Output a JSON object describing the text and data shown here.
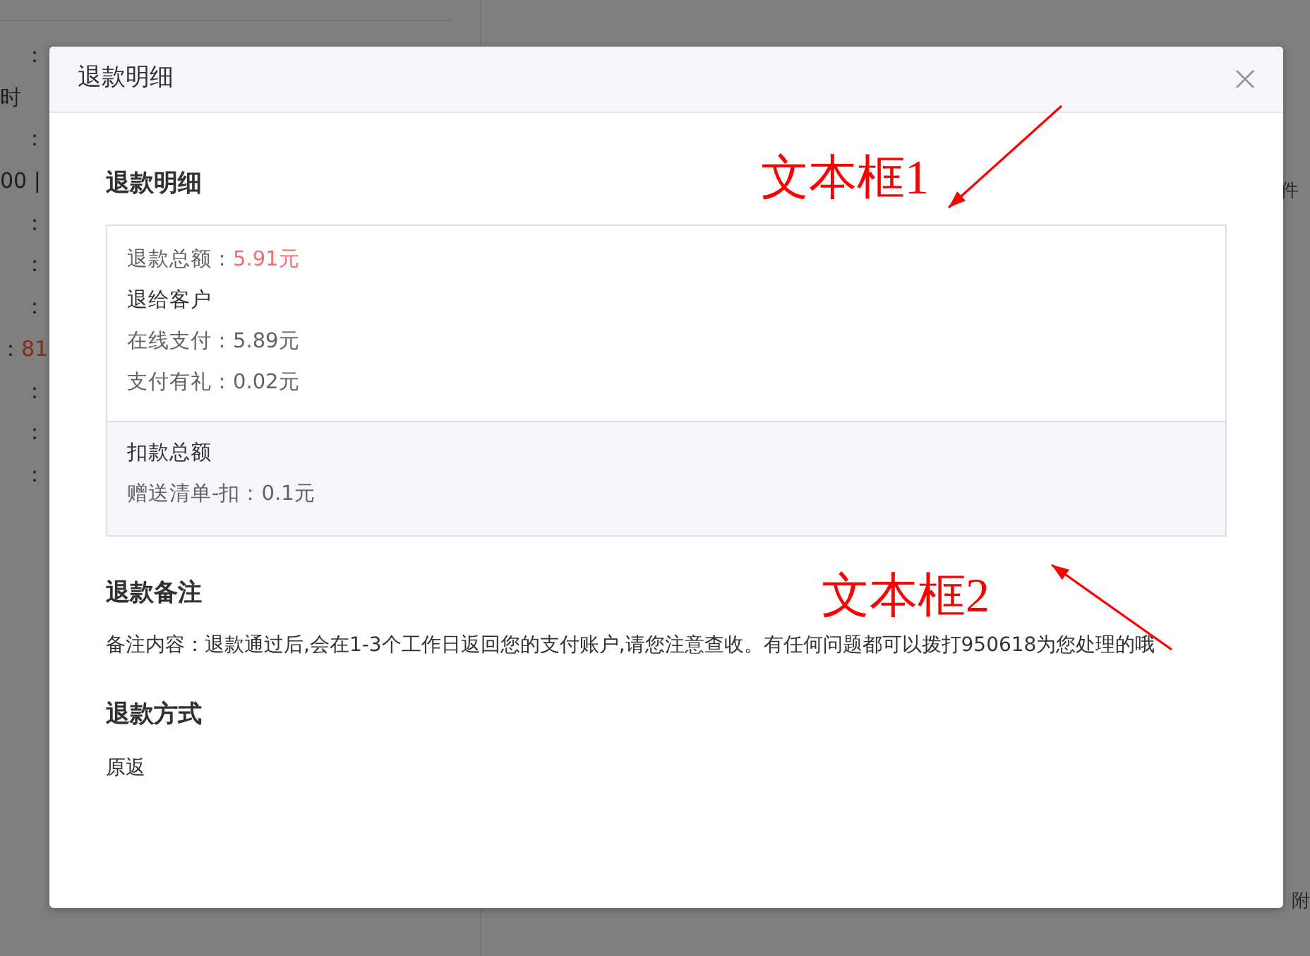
{
  "background": {
    "labels": [
      {
        "text": "："
      },
      {
        "text": "时"
      },
      {
        "text": "："
      },
      {
        "text": "00 |"
      },
      {
        "text": "："
      },
      {
        "text": "："
      },
      {
        "text": "："
      },
      {
        "text": "：",
        "value": "81"
      },
      {
        "text": "："
      },
      {
        "text": "："
      },
      {
        "text": "："
      }
    ],
    "right_texts": [
      "件",
      "附"
    ]
  },
  "dialog": {
    "title": "退款明细",
    "sections": [
      {
        "heading": "退款明细",
        "kind": "panel",
        "groups": [
          {
            "lines": [
              {
                "kind": "total",
                "label": "退款总额：",
                "value": "5.91元"
              },
              {
                "kind": "subheading",
                "text": "退给客户"
              },
              {
                "kind": "item",
                "text": "在线支付：5.89元"
              },
              {
                "kind": "item",
                "text": "支付有礼：0.02元"
              }
            ]
          },
          {
            "lines": [
              {
                "kind": "subheading",
                "text": "扣款总额"
              },
              {
                "kind": "item",
                "text": "赠送清单-扣：0.1元"
              }
            ]
          }
        ]
      },
      {
        "heading": "退款备注",
        "kind": "text",
        "text": "备注内容：退款通过后,会在1-3个工作日返回您的支付账户,请您注意查收。有任何问题都可以拨打950618为您处理的哦"
      },
      {
        "heading": "退款方式",
        "kind": "text",
        "text": "原返"
      }
    ]
  },
  "annotations": [
    {
      "text": "文本框1"
    },
    {
      "text": "文本框2"
    }
  ]
}
